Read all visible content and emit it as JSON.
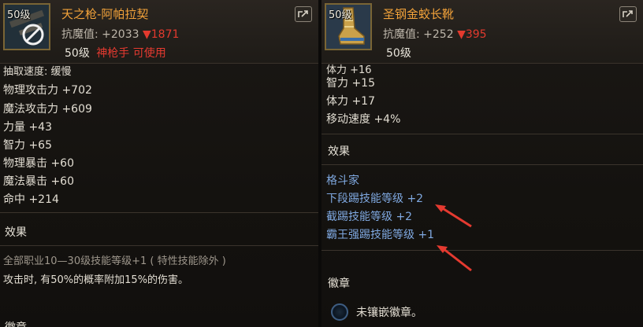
{
  "left_item": {
    "level_badge": "50级",
    "name": "天之枪-阿帕拉契",
    "stat_label": "抗魔值:",
    "stat_value": "+2033",
    "stat_delta": "▼1871",
    "level": "50级",
    "class_requirement": "神枪手 可使用",
    "top_partial": "抽取速度: 缓慢",
    "stats": [
      "物理攻击力 +702",
      "魔法攻击力 +609",
      "力量 +43",
      "智力 +65",
      "物理暴击 +60",
      "魔法暴击 +60",
      "命中 +214"
    ],
    "effects_title": "效果",
    "effects": [
      "全部职业10—30级技能等级+1 ( 特性技能除外 )",
      "攻击时, 有50%的概率附加15%的伤害。"
    ],
    "bottom_partial": "徽章"
  },
  "right_item": {
    "level_badge": "50级",
    "name": "圣钢金蛟长靴",
    "stat_label": "抗魔值:",
    "stat_value": "+252",
    "stat_delta": "▼395",
    "level": "50级",
    "top_partial": "体力 +16",
    "stats": [
      "智力 +15",
      "体力 +17",
      "移动速度 +4%"
    ],
    "effects_title": "效果",
    "effects": [
      "格斗家",
      "下段踢技能等级 +2",
      "截踢技能等级 +2",
      "霸王强踢技能等级 +1"
    ],
    "emblem_title": "徽章",
    "emblem_text": "未镶嵌徽章。"
  },
  "colors": {
    "item_name": "#f2a23a",
    "stat_down": "#e33a2e",
    "effect_blue": "#7fa8e0",
    "annotation_arrow": "#e53a30"
  },
  "icons": [
    "weapon-forbidden-icon",
    "boots-icon",
    "export-icon",
    "emblem-slot-icon",
    "red-arrow-annotation"
  ]
}
